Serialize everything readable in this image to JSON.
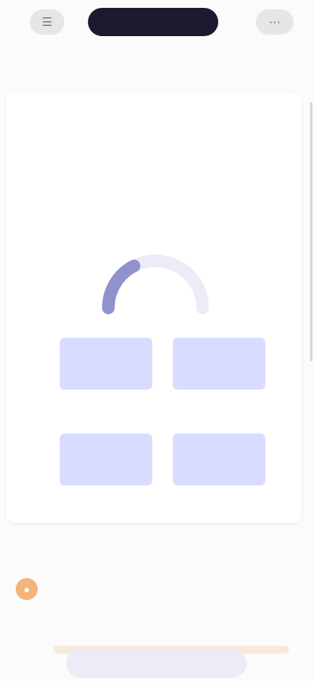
{
  "topbar": {
    "left_icon": "menu-icon",
    "right_icon": "more-icon",
    "pill_label": ""
  },
  "tabs": {
    "left": "",
    "active": "",
    "right": ""
  },
  "card": {
    "title": "",
    "lines": [
      "",
      "",
      "",
      ""
    ],
    "gauge": {
      "fill_fraction": 0.35,
      "color": "#8f92cc",
      "track_color": "#ececf6",
      "value_label": ""
    },
    "metrics": [
      {
        "label": "",
        "value": ""
      },
      {
        "label": "",
        "value": ""
      },
      {
        "label": "",
        "value": ""
      },
      {
        "label": "",
        "value": ""
      }
    ]
  },
  "section": {
    "title": ""
  },
  "feed": {
    "avatar_color": "#f3b37a",
    "title": "",
    "text": "",
    "sub": ""
  },
  "bottom_button": {
    "label": ""
  }
}
